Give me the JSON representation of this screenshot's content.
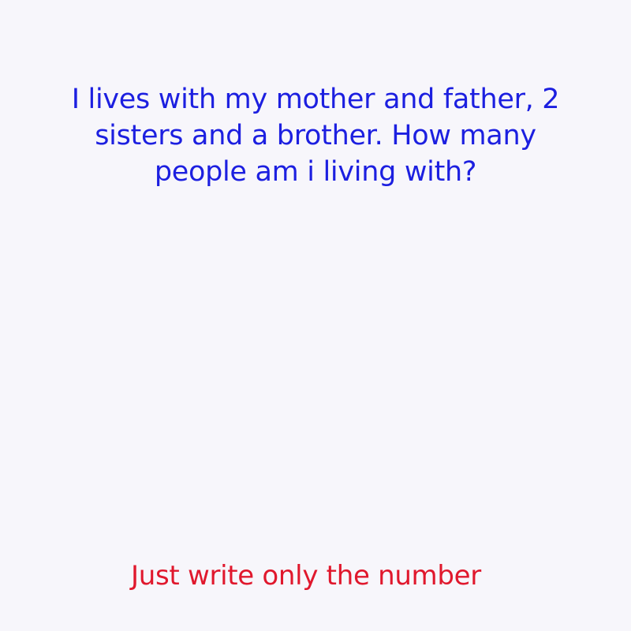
{
  "question": {
    "text": "I lives with my mother and father, 2 sisters and a brother. How many people am i living with?",
    "color": "#1c1fe0"
  },
  "instruction": {
    "text": "Just write only the number",
    "color": "#e0182d"
  },
  "background_color": "#f7f6fb"
}
